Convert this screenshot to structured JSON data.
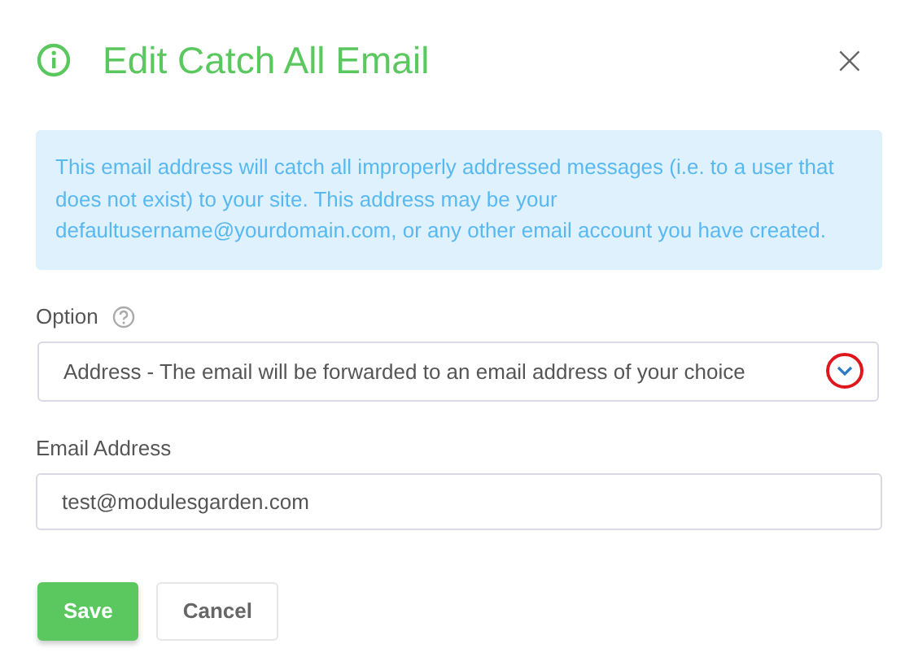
{
  "dialog": {
    "title": "Edit Catch All Email",
    "close": "×"
  },
  "info": "This email address will catch all improperly addressed messages (i.e. to a user that does not exist) to your site. This address may be your defaultusername@yourdomain.com, or any other email account you have created.",
  "fields": [
    {
      "kind": "select",
      "label": "Option",
      "help": true,
      "value": "Address - The email will be forwarded to an email address of your choice",
      "highlighted": true
    },
    {
      "kind": "text",
      "label": "Email Address",
      "help": false,
      "value": "test@modulesgarden.com"
    }
  ],
  "buttons": [
    {
      "label": "Save",
      "primary": true
    },
    {
      "label": "Cancel",
      "primary": false
    }
  ]
}
